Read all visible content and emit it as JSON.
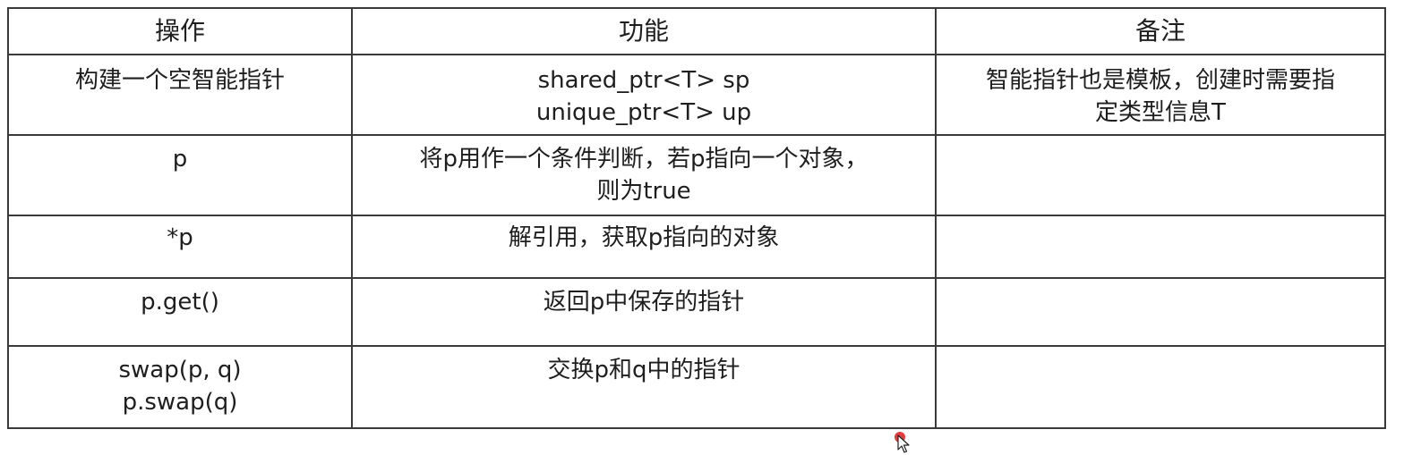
{
  "table": {
    "headers": [
      "操作",
      "功能",
      "备注"
    ],
    "rows": [
      {
        "operation": [
          "构建一个空智能指针"
        ],
        "function": [
          "shared_ptr<T> sp",
          "unique_ptr<T> up"
        ],
        "note": [
          "智能指针也是模板，创建时需要指",
          "定类型信息T"
        ]
      },
      {
        "operation": [
          "p"
        ],
        "function": [
          "将p用作一个条件判断，若p指向一个对象，",
          "则为true"
        ],
        "note": []
      },
      {
        "operation": [
          "*p"
        ],
        "function": [
          "解引用，获取p指向的对象"
        ],
        "note": []
      },
      {
        "operation": [
          "p.get()"
        ],
        "function": [
          "返回p中保存的指针"
        ],
        "note": []
      },
      {
        "operation": [
          "swap(p, q)",
          "p.swap(q)"
        ],
        "function": [
          "交换p和q中的指针"
        ],
        "note": []
      }
    ]
  },
  "cursor": {
    "icon": "mouse-pointer-icon",
    "highlight_color": "#e0191e"
  }
}
